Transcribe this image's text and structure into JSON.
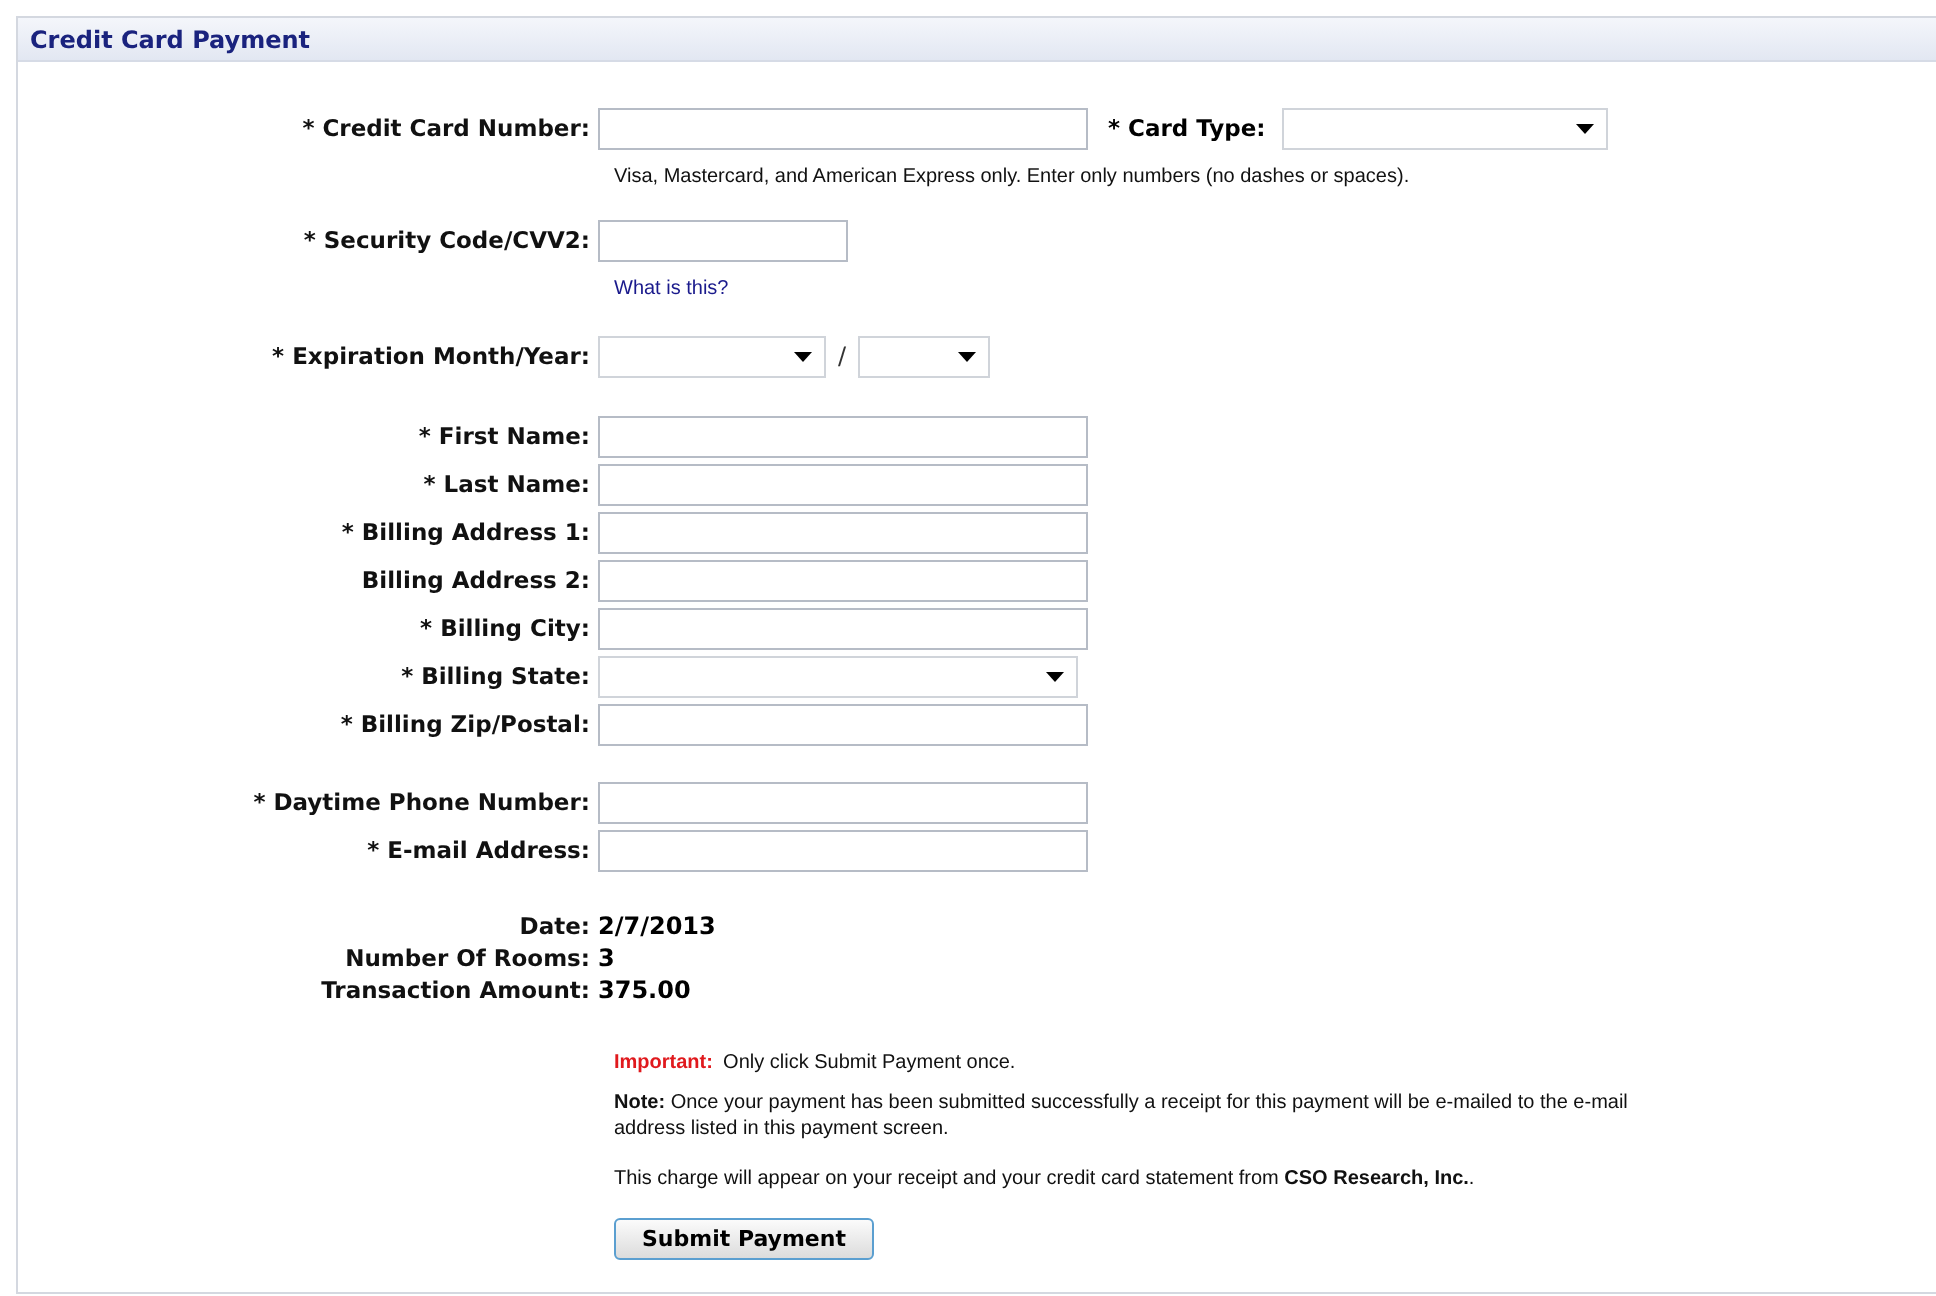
{
  "panel_title": "Credit Card Payment",
  "card_number": {
    "label": "* Credit Card Number:",
    "hint": "Visa, Mastercard, and American Express only. Enter only numbers (no dashes or spaces)."
  },
  "card_type": {
    "label": "* Card Type:"
  },
  "security_code": {
    "label": "* Security Code/CVV2:",
    "link": "What is this?"
  },
  "expiration": {
    "label": "* Expiration Month/Year:",
    "separator": "/"
  },
  "billing_fields": [
    {
      "label": "* First Name:",
      "kind": "text"
    },
    {
      "label": "* Last Name:",
      "kind": "text"
    },
    {
      "label": "* Billing Address 1:",
      "kind": "text"
    },
    {
      "label": "Billing Address 2:",
      "kind": "text"
    },
    {
      "label": "* Billing City:",
      "kind": "text"
    },
    {
      "label": "* Billing State:",
      "kind": "select"
    },
    {
      "label": "* Billing Zip/Postal:",
      "kind": "text"
    }
  ],
  "contact_fields": [
    {
      "label": "* Daytime Phone Number:",
      "kind": "text"
    },
    {
      "label": "* E-mail Address:",
      "kind": "text"
    }
  ],
  "summary": [
    {
      "label": "Date:",
      "value": "2/7/2013"
    },
    {
      "label": "Number Of Rooms:",
      "value": "3"
    },
    {
      "label": "Transaction Amount:",
      "value": "375.00"
    }
  ],
  "important": {
    "label": "Important:",
    "text": "Only click Submit Payment once."
  },
  "note": "**Note:** Once your payment has been submitted successfully a receipt for this payment will be e-mailed to the e-mail address listed in this payment screen.",
  "charge_notice": "This charge will appear on your receipt and your credit card statement from **CSO Research, Inc.**.",
  "submit_button": "Submit Payment"
}
